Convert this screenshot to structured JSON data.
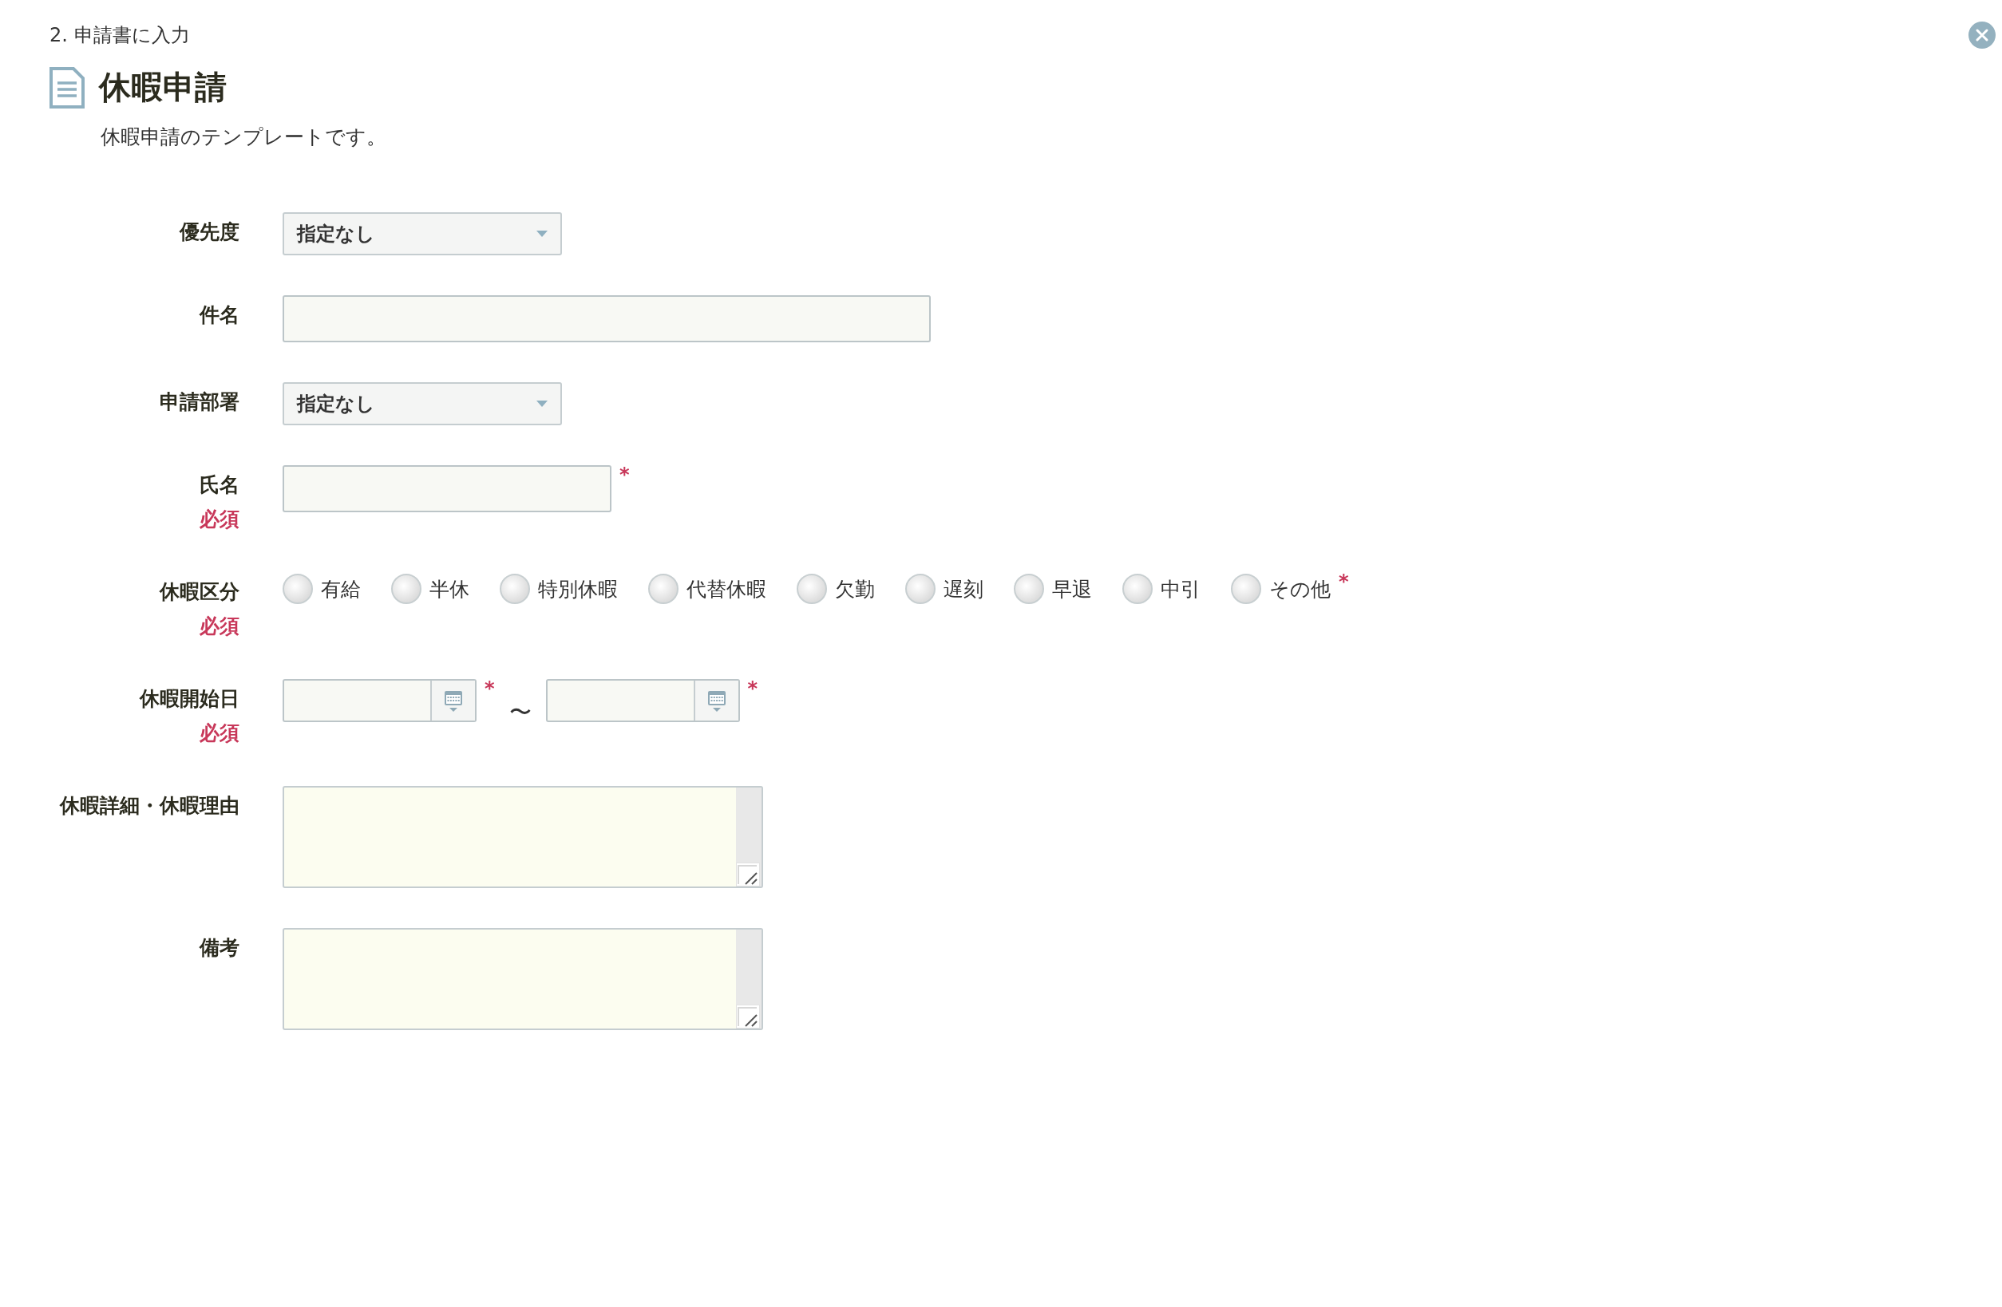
{
  "step": "2. 申請書に入力",
  "title": "休暇申請",
  "description": "休暇申請のテンプレートです。",
  "fields": [
    {
      "kind": "select",
      "label": "優先度",
      "value": "指定なし"
    },
    {
      "kind": "text",
      "label": "件名"
    },
    {
      "kind": "select",
      "label": "申請部署",
      "value": "指定なし"
    },
    {
      "kind": "text",
      "label": "氏名",
      "required_note": "必須",
      "marker": "*"
    },
    {
      "kind": "radios",
      "label": "休暇区分",
      "required_note": "必須",
      "marker": "*",
      "options": [
        {
          "label": "有給",
          "selected": false
        },
        {
          "label": "半休",
          "selected": false
        },
        {
          "label": "特別休暇",
          "selected": false
        },
        {
          "label": "代替休暇",
          "selected": false
        },
        {
          "label": "欠勤",
          "selected": false
        },
        {
          "label": "遅刻",
          "selected": false
        },
        {
          "label": "早退",
          "selected": false
        },
        {
          "label": "中引",
          "selected": false
        },
        {
          "label": "その他",
          "selected": false
        }
      ]
    },
    {
      "kind": "daterange",
      "label": "休暇開始日",
      "required_note": "必須",
      "separator": "〜",
      "ends": [
        {
          "marker": "*"
        },
        {
          "marker": "*"
        }
      ]
    },
    {
      "kind": "textarea",
      "label": "休暇詳細・休暇理由"
    },
    {
      "kind": "textarea",
      "label": "備考"
    }
  ]
}
